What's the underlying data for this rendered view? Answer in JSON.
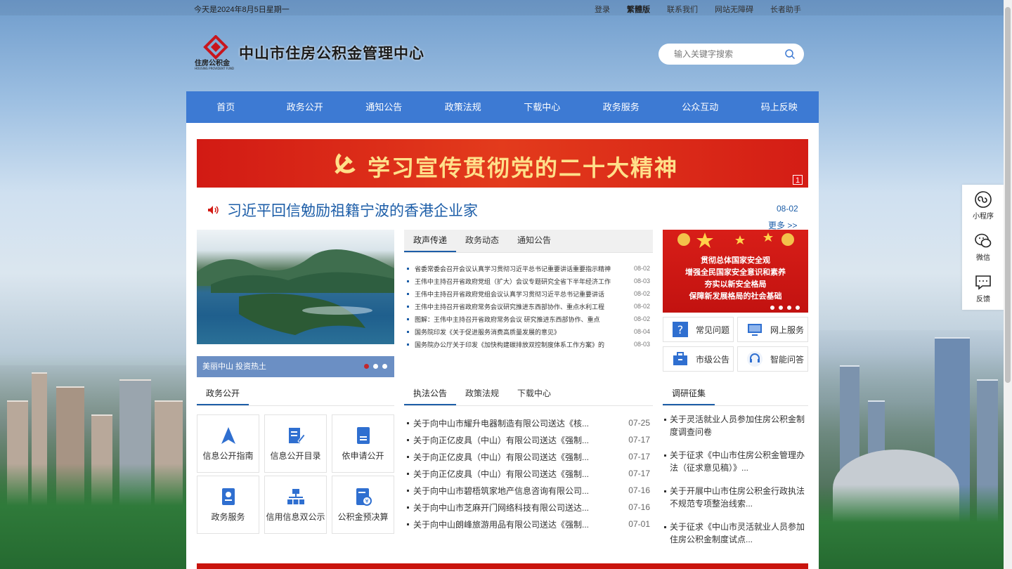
{
  "topbar": {
    "date": "今天是2024年8月5日星期一",
    "links": [
      "登录",
      "繁體版",
      "联系我们",
      "网站无障碍",
      "长者助手"
    ]
  },
  "header": {
    "logo_caption": "住房公积金",
    "logo_caption_en": "HOUSING PROVIDENT FUND",
    "site_title": "中山市住房公积金管理中心",
    "search_placeholder": "输入关键字搜索"
  },
  "nav": [
    "首页",
    "政务公开",
    "通知公告",
    "政策法规",
    "下载中心",
    "政务服务",
    "公众互动",
    "码上反映"
  ],
  "banner": {
    "text": "学习宣传贯彻党的二十大精神",
    "page": "1"
  },
  "headline": {
    "title": "习近平回信勉励祖籍宁波的香港企业家",
    "date": "08-02",
    "more": "更多 >>"
  },
  "photo": {
    "caption": "美丽中山 投资热土"
  },
  "news_tabs": [
    "政声传递",
    "政务动态",
    "通知公告"
  ],
  "news": [
    {
      "title": "省委常委会召开会议认真学习贯彻习近平总书记重要讲话重要指示精神",
      "date": "08-02"
    },
    {
      "title": "王伟中主持召开省政府党组（扩大）会议专题研究全省下半年经济工作",
      "date": "08-03"
    },
    {
      "title": "王伟中主持召开省政府党组会议认真学习贯彻习近平总书记重要讲话",
      "date": "08-02"
    },
    {
      "title": "王伟中主持召开省政府常务会议研究推进东西部协作、重点水利工程",
      "date": "08-02"
    },
    {
      "title": "图解：王伟中主持召开省政府常务会议 研究推进东西部协作、重点",
      "date": "08-02"
    },
    {
      "title": "国务院印发《关于促进服务消费高质量发展的意见》",
      "date": "08-04"
    },
    {
      "title": "国务院办公厅关于印发《加快构建碳排放双控制度体系工作方案》的",
      "date": "08-03"
    }
  ],
  "safety": {
    "lines": [
      "贯彻总体国家安全观",
      "增强全民国家安全意识和素养",
      "夯实以新安全格局",
      "保障新发展格局的社会基础"
    ]
  },
  "quick": [
    {
      "label": "常见问题",
      "icon": "question-icon"
    },
    {
      "label": "网上服务",
      "icon": "monitor-icon"
    },
    {
      "label": "市级公告",
      "icon": "briefcase-icon"
    },
    {
      "label": "智能问答",
      "icon": "headset-icon"
    }
  ],
  "gov": {
    "tab": "政务公开",
    "items": [
      {
        "label": "信息公开指南",
        "icon": "navigation-icon"
      },
      {
        "label": "信息公开目录",
        "icon": "edit-document-icon"
      },
      {
        "label": "依申请公开",
        "icon": "document-icon"
      },
      {
        "label": "政务服务",
        "icon": "id-badge-icon"
      },
      {
        "label": "信用信息双公示",
        "icon": "org-chart-icon"
      },
      {
        "label": "公积金预决算",
        "icon": "finance-document-icon"
      }
    ]
  },
  "law_tabs": [
    "执法公告",
    "政策法规",
    "下载中心"
  ],
  "law": [
    {
      "title": "关于向中山市耀升电器制造有限公司送达《核...",
      "date": "07-25"
    },
    {
      "title": "关于向正亿皮具（中山）有限公司送达《强制...",
      "date": "07-17"
    },
    {
      "title": "关于向正亿皮具（中山）有限公司送达《强制...",
      "date": "07-17"
    },
    {
      "title": "关于向正亿皮具（中山）有限公司送达《强制...",
      "date": "07-17"
    },
    {
      "title": "关于向中山市碧梧筑家地产信息咨询有限公司...",
      "date": "07-16"
    },
    {
      "title": "关于向中山市芝麻开门网络科技有限公司送达...",
      "date": "07-16"
    },
    {
      "title": "关于向中山朗峰旅游用品有限公司送达《强制...",
      "date": "07-01"
    }
  ],
  "survey": {
    "tab": "调研征集",
    "items": [
      "关于灵活就业人员参加住房公积金制度调查问卷",
      "关于征求《中山市住房公积金管理办法（征求意见稿）》...",
      "关于开展中山市住房公积金行政执法不规范专项整治线索...",
      "关于征求《中山市灵活就业人员参加住房公积金制度试点..."
    ]
  },
  "side": [
    "小程序",
    "微信",
    "反馈"
  ],
  "colors": {
    "nav": "#3d7ad3",
    "accent": "#1d5ea8",
    "banner": "#d21a14"
  }
}
